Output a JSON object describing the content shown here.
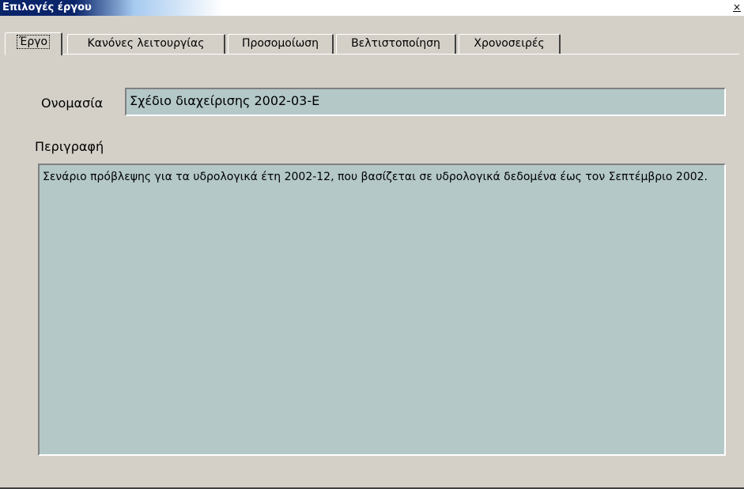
{
  "window": {
    "title": "Επιλογές έργου",
    "close_glyph": "×"
  },
  "tabs": [
    {
      "label": "Έργο",
      "active": true
    },
    {
      "label": "Κανόνες λειτουργίας",
      "active": false
    },
    {
      "label": "Προσομοίωση",
      "active": false
    },
    {
      "label": "Βελτιστοποίηση",
      "active": false
    },
    {
      "label": "Χρονοσειρές",
      "active": false
    }
  ],
  "form": {
    "name_label": "Ονομασία",
    "name_value": "Σχέδιο διαχείρισης 2002-03-Ε",
    "description_label": "Περιγραφή",
    "description_value": "Σενάριο πρόβλεψης για τα υδρολογικά έτη 2002-12, που βασίζεται σε υδρολογικά δεδομένα έως τον Σεπτέμβριο 2002."
  },
  "colors": {
    "field_background": "#b4c8c8",
    "dialog_background": "#d4d0c8",
    "titlebar_start": "#0a246a"
  }
}
